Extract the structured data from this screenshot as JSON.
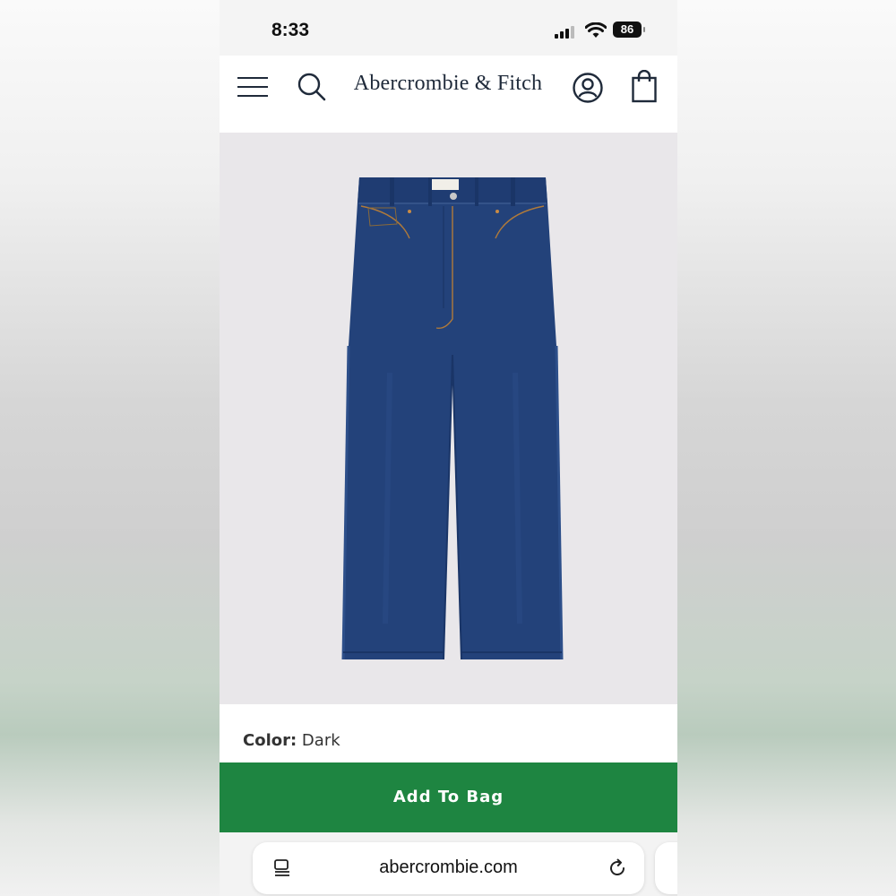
{
  "status_bar": {
    "time": "8:33",
    "battery": "86"
  },
  "header": {
    "brand": "Abercrombie & Fitch",
    "icons": [
      "menu-icon",
      "search-icon",
      "account-icon",
      "shopping-bag-icon"
    ]
  },
  "product": {
    "image_description_icon": "jeans-image",
    "color_label": "Color:",
    "color_value": "Dark"
  },
  "actions": {
    "add_to_bag_label": "Add To Bag"
  },
  "browser": {
    "url": "abercrombie.com",
    "icons": [
      "reader-icon",
      "reload-icon"
    ]
  },
  "colors": {
    "accent_green": "#1e8541",
    "brand_navy": "#1f2a3a",
    "denim": "#23427a",
    "product_bg": "#e9e7ea"
  }
}
